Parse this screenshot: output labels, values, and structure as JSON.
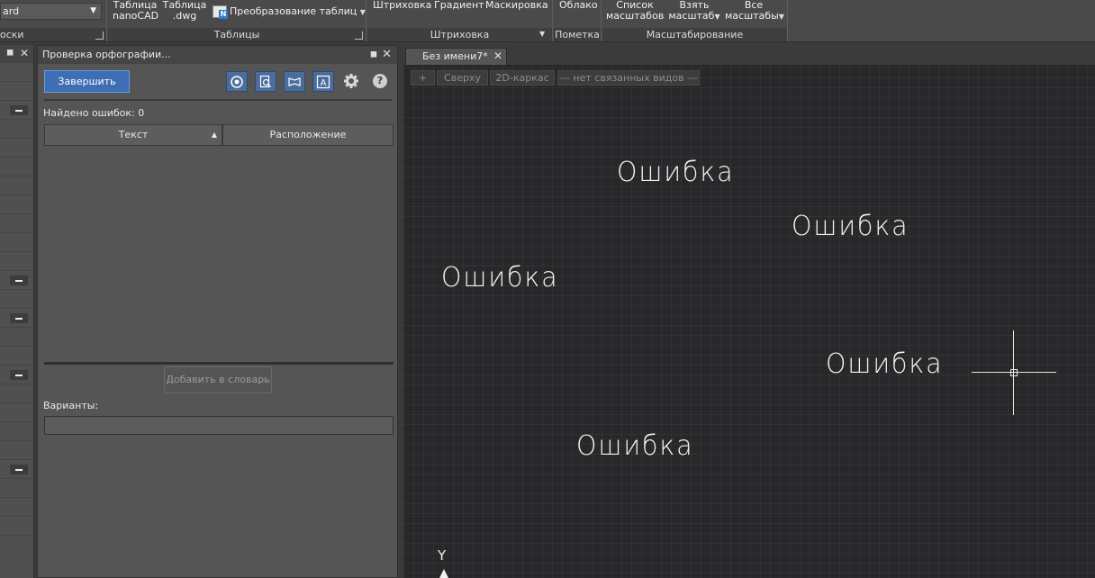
{
  "ribbon": {
    "combo_value": "ard",
    "group1_title": "оски",
    "tables": {
      "btn_table_nanocad_l1": "Таблица",
      "btn_table_nanocad_l2": "nanoCAD",
      "btn_table_dwg_l1": "Таблица",
      "btn_table_dwg_l2": ".dwg",
      "btn_convert": "Преобразование таблиц",
      "title": "Таблицы"
    },
    "hatch": {
      "btn_hatch": "Штриховка",
      "btn_gradient": "Градиент",
      "btn_masking": "Маскировка",
      "title": "Штриховка"
    },
    "markup": {
      "btn_cloud": "Облако",
      "title": "Пометка"
    },
    "scaling": {
      "btn_list_l1": "Список",
      "btn_list_l2": "масштабов",
      "btn_take_l1": "Взять",
      "btn_take_l2": "масштаб",
      "btn_all_l1": "Все",
      "btn_all_l2": "масштабы",
      "title": "Масштабирование"
    }
  },
  "spell_panel": {
    "title": "Проверка орфографии...",
    "finish_label": "Завершить",
    "found_text": "Найдено ошибок: 0",
    "col_text": "Текст",
    "col_location": "Расположение",
    "add_to_dict_label": "Добавить в словарь",
    "variants_label": "Варианты:",
    "variants_value": ""
  },
  "drawing": {
    "tab_title": "Без имени7*",
    "viewport": {
      "plus": "+",
      "view": "Сверху",
      "style": "2D-каркас",
      "linked": "--- нет связанных видов ---"
    },
    "texts": [
      "Ошибка",
      "Ошибка",
      "Ошибка",
      "Ошибка",
      "Ошибка"
    ],
    "ucs_axis_label": "Y"
  },
  "colors": {
    "accent_button": "#3e6eb3",
    "canvas_bg": "#28282b",
    "panel_bg": "#555555"
  }
}
